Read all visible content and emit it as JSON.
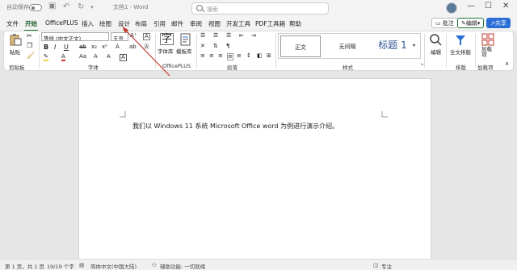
{
  "titlebar": {
    "autosave_label": "自动保存",
    "autosave_state": "关",
    "doc_title": "文档1 - Word",
    "search_placeholder": "搜索",
    "min": "—",
    "max": "☐",
    "close": "✕"
  },
  "tabs": [
    "文件",
    "开始",
    "OfficePLUS",
    "插入",
    "绘图",
    "设计",
    "布局",
    "引用",
    "邮件",
    "审阅",
    "视图",
    "开发工具",
    "PDF工具箱",
    "帮助"
  ],
  "active_tab": "开始",
  "right_buttons": {
    "comment": "批注",
    "edit": "编辑",
    "share": "共享"
  },
  "ribbon": {
    "clipboard": {
      "paste": "粘贴",
      "group": "剪贴板"
    },
    "font": {
      "font_name": "等线 (中文正文)",
      "font_size": "五号",
      "group": "字体"
    },
    "officeplus": {
      "font_lib": "字体库",
      "template_lib": "模板库",
      "group": "OfficePLUS"
    },
    "paragraph": {
      "group": "段落"
    },
    "styles": {
      "items": [
        "正文",
        "无间隔",
        "标题 1"
      ],
      "group": "样式"
    },
    "editing": {
      "find_label": "编辑"
    },
    "layout": {
      "full_layout": "全文排版",
      "group": "排版"
    },
    "addins": {
      "label": "加载项",
      "group": "加载项"
    }
  },
  "document": {
    "body_text": "我们以 Windows 11 系统 Microsoft Office word 为例进行演示介绍。"
  },
  "status": {
    "page": "第 1 页，共 1 页",
    "words": "19/19 个字",
    "language": "简体中文(中国大陆)",
    "accessibility": "辅助功能: 一切就绪",
    "zoom_label": "专注"
  },
  "colors": {
    "accent": "#1e7a34",
    "share": "#2b6fd6",
    "arrow": "#c0392b"
  }
}
